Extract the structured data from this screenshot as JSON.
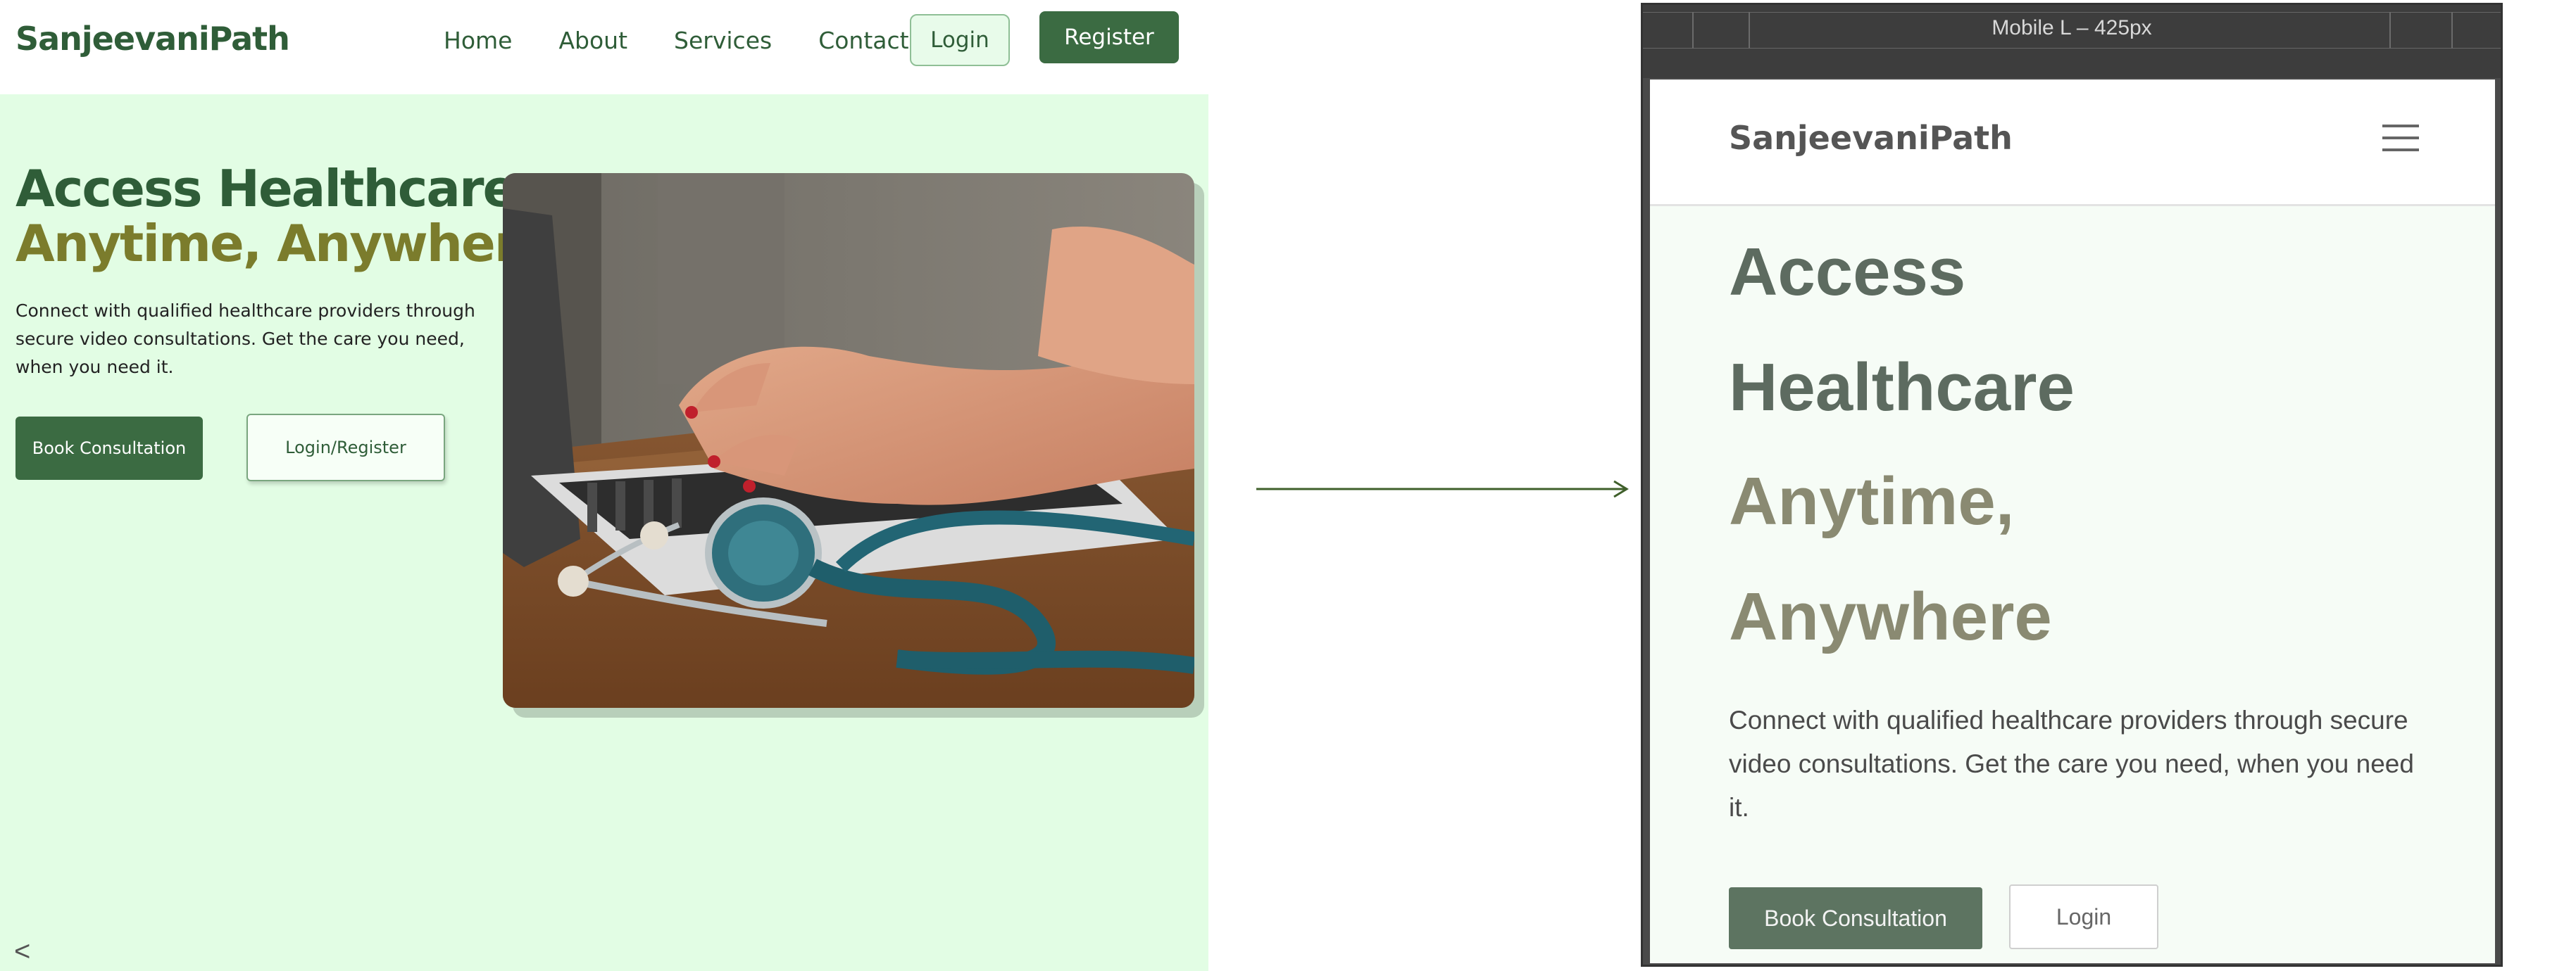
{
  "desktop": {
    "logo": "SanjeevaniPath",
    "nav": [
      "Home",
      "About",
      "Services",
      "Contact"
    ],
    "login": "Login",
    "register": "Register",
    "headline_line1": "Access Healthcare",
    "headline_line2": "Anytime, Anywhere",
    "paragraph": "Connect with qualified healthcare providers through secure video consultations. Get the care you need, when you need it.",
    "book_button": "Book Consultation",
    "login_register_button": "Login/Register",
    "back_glyph": "<",
    "image_subject": "laptop-stethoscope-photo"
  },
  "mobile": {
    "frame_label": "Mobile L – 425px",
    "logo": "SanjeevaniPath",
    "menu_icon": "hamburger-icon",
    "headline_lines_dark": [
      "Access",
      "Healthcare"
    ],
    "headline_lines_olive": [
      "Anytime,",
      "Anywhere"
    ],
    "paragraph": "Connect with qualified healthcare providers through secure video consultations. Get the care you need, when you need it.",
    "book_button": "Book Consultation",
    "login_button": "Login"
  },
  "colors": {
    "brand_green": "#2f5d38",
    "button_green": "#3b6b42",
    "hero_bg": "#e2fde4",
    "olive": "#7b7c2c",
    "arrow": "#3f5f2a"
  }
}
